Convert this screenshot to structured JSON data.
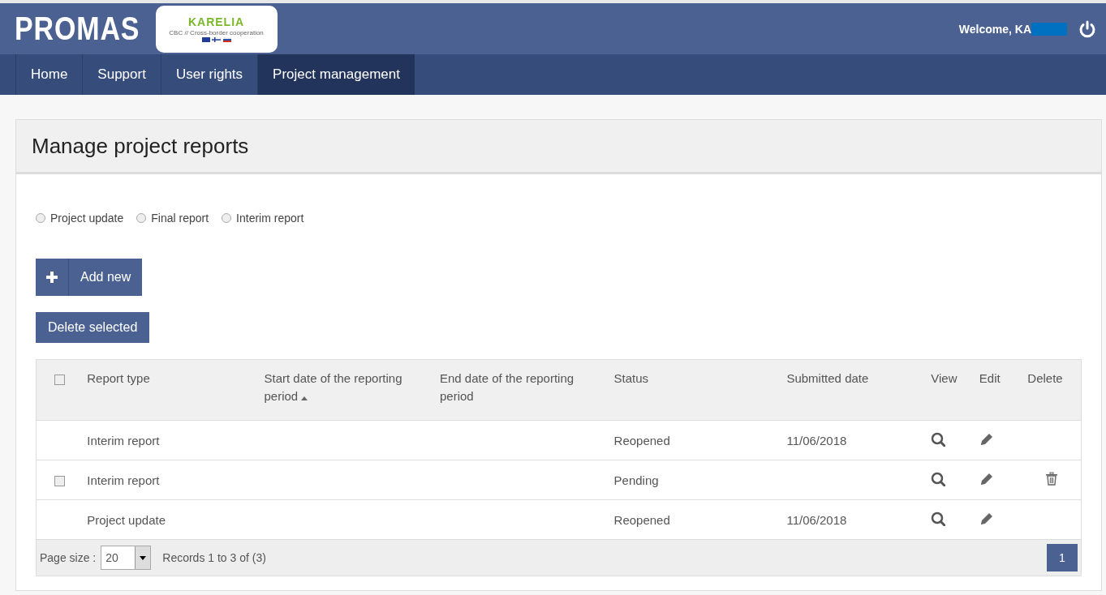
{
  "header": {
    "brand": "PROMAS",
    "logo": {
      "title": "KARELIA",
      "subtitle": "CBC // Cross-border cooperation"
    },
    "welcome": "Welcome, KA"
  },
  "nav": [
    {
      "label": "Home",
      "selected": false
    },
    {
      "label": "Support",
      "selected": false
    },
    {
      "label": "User rights",
      "selected": false
    },
    {
      "label": "Project management",
      "selected": true
    }
  ],
  "page": {
    "title": "Manage project reports",
    "filters": [
      {
        "label": "Project update",
        "selected": false
      },
      {
        "label": "Final report",
        "selected": false
      },
      {
        "label": "Interim report",
        "selected": false
      }
    ],
    "add_button": "Add new",
    "delete_button": "Delete selected",
    "table": {
      "select_all": {
        "checked": false
      },
      "columns": [
        {
          "label": "Report type",
          "sorted": false
        },
        {
          "label": "Start date of the reporting period",
          "sorted": true
        },
        {
          "label": "End date of the reporting period",
          "sorted": false
        },
        {
          "label": "Status",
          "sorted": false
        },
        {
          "label": "Submitted date",
          "sorted": false
        },
        {
          "label": "View",
          "sorted": false
        },
        {
          "label": "Edit",
          "sorted": false
        },
        {
          "label": "Delete",
          "sorted": false
        }
      ],
      "rows": [
        {
          "selectable": false,
          "type": "Interim report",
          "status": "Reopened",
          "submitted": "11/06/2018",
          "deletable": false
        },
        {
          "selectable": true,
          "checked": false,
          "type": "Interim report",
          "status": "Pending",
          "deletable": true
        },
        {
          "selectable": false,
          "type": "Project update",
          "status": "Reopened",
          "submitted": "11/06/2018",
          "deletable": false
        }
      ],
      "footer": {
        "page_size_label": "Page size :",
        "page_size": "20",
        "records": "Records 1 to 3 of (3)",
        "pages": [
          {
            "label": "1",
            "selected": true
          }
        ]
      }
    }
  }
}
